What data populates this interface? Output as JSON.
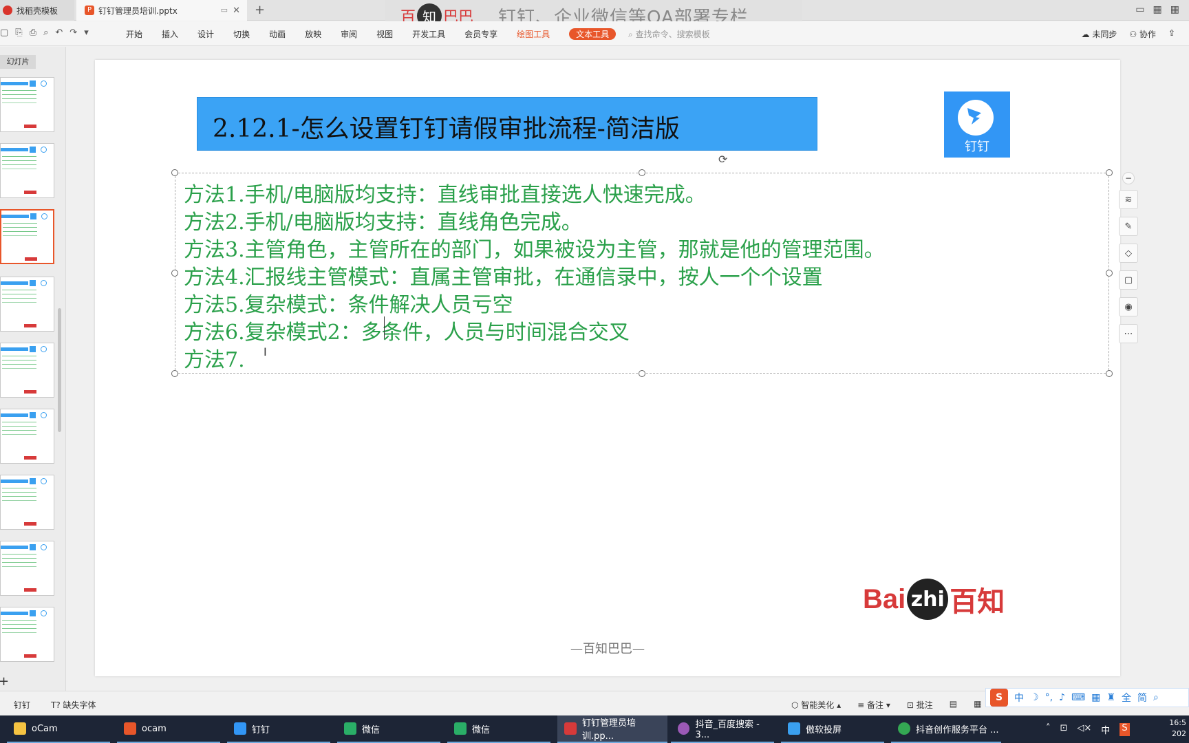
{
  "tabs": [
    {
      "label": "找稻壳模板"
    },
    {
      "label": "钉钉管理员培训.pptx"
    }
  ],
  "watermark": {
    "brand_left": "百",
    "brand_circle": "知",
    "brand_right": "巴巴",
    "title": "钉钉、企业微信等OA部署专栏"
  },
  "ribbon": {
    "menu": [
      "开始",
      "插入",
      "设计",
      "切换",
      "动画",
      "放映",
      "审阅",
      "视图",
      "开发工具",
      "会员专享"
    ],
    "tool_hl": "绘图工具",
    "tool_pill": "文本工具",
    "search": "查找命令、搜索模板",
    "sync": "未同步",
    "collab": "协作"
  },
  "panel": {
    "label": "幻灯片"
  },
  "slide": {
    "title": "2.12.1-怎么设置钉钉请假审批流程-简洁版",
    "logo_text": "钉钉",
    "lines": [
      "方法1.手机/电脑版均支持：直线审批直接选人快速完成。",
      "方法2.手机/电脑版均支持：直线角色完成。",
      "方法3.主管角色，主管所在的部门，如果被设为主管，那就是他的管理范围。",
      "方法4.汇报线主管模式：直属主管审批，在通信录中，按人一个个设置",
      "方法5.复杂模式：条件解决人员亏空",
      "方法6.复杂模式2：多条件，人员与时间混合交叉",
      "方法7."
    ],
    "baizhi_red": "Bai",
    "baizhi_circle": "zhi",
    "baizhi_cn": "百知",
    "footer": "—百知巴巴—"
  },
  "statusbar": {
    "left1": "钉钉",
    "left2": "缺失字体",
    "beautify": "智能美化",
    "notes": "备注",
    "comment": "批注"
  },
  "ime": {
    "s": "S",
    "cn": "中"
  },
  "taskbar": [
    {
      "label": "oCam",
      "color": "#f5c342"
    },
    {
      "label": "ocam",
      "color": "#e8562a"
    },
    {
      "label": "钉钉",
      "color": "#3296f5"
    },
    {
      "label": "微信",
      "color": "#2aae67"
    },
    {
      "label": "微信",
      "color": "#2aae67"
    },
    {
      "label": "钉钉管理员培训.pp...",
      "color": "#d73a3a"
    },
    {
      "label": "抖音_百度搜索 - 3...",
      "color": "#9b59b6"
    },
    {
      "label": "傲软投屏",
      "color": "#3aa0f0"
    },
    {
      "label": "抖音创作服务平台 ...",
      "color": "#34a853"
    }
  ],
  "tray": {
    "lang": "中",
    "time": "16:5",
    "date": "202"
  }
}
